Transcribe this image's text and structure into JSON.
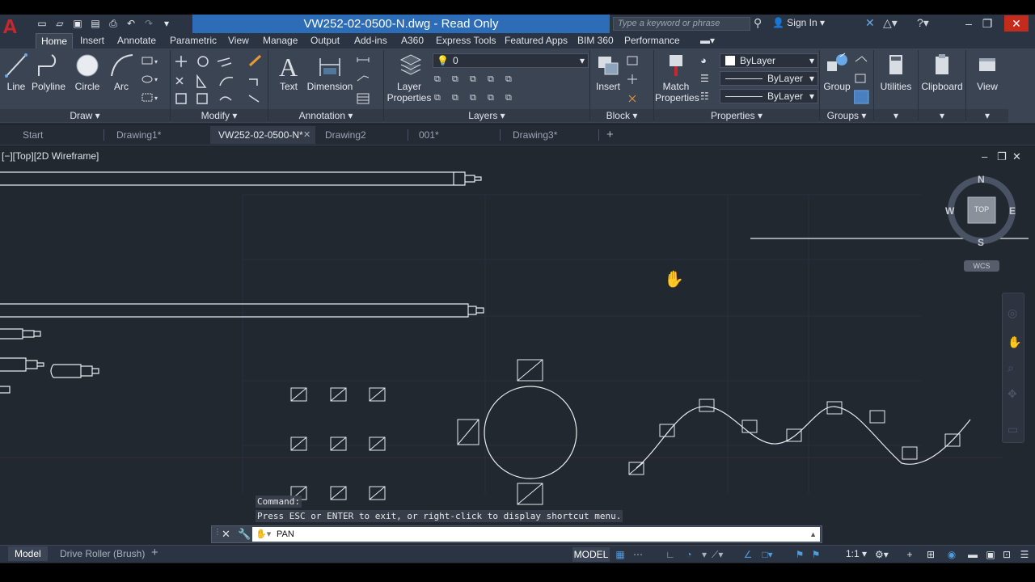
{
  "window": {
    "title": "VW252-02-0500-N.dwg - Read Only",
    "search_placeholder": "Type a keyword or phrase",
    "sign_in": "Sign In"
  },
  "ribbon_tabs": [
    {
      "label": "Home",
      "active": true
    },
    {
      "label": "Insert"
    },
    {
      "label": "Annotate"
    },
    {
      "label": "Parametric"
    },
    {
      "label": "View"
    },
    {
      "label": "Manage"
    },
    {
      "label": "Output"
    },
    {
      "label": "Add-ins"
    },
    {
      "label": "A360"
    },
    {
      "label": "Express Tools"
    },
    {
      "label": "Featured Apps"
    },
    {
      "label": "BIM 360"
    },
    {
      "label": "Performance"
    }
  ],
  "draw_panel": {
    "title": "Draw",
    "tools": [
      "Line",
      "Polyline",
      "Circle",
      "Arc"
    ]
  },
  "modify_panel": {
    "title": "Modify"
  },
  "annotation_panel": {
    "title": "Annotation",
    "tools": [
      "Text",
      "Dimension"
    ]
  },
  "layers_panel": {
    "title": "Layers",
    "layer_properties": "Layer\nProperties",
    "layer_properties_l1": "Layer",
    "layer_properties_l2": "Properties",
    "current_layer": "0"
  },
  "block_panel": {
    "title": "Block",
    "insert": "Insert"
  },
  "properties_panel": {
    "title": "Properties",
    "match_l1": "Match",
    "match_l2": "Properties",
    "color": "ByLayer",
    "linetype": "ByLayer",
    "lineweight": "ByLayer"
  },
  "groups_panel": {
    "title": "Groups",
    "group": "Group"
  },
  "utilities": "Utilities",
  "clipboard": "Clipboard",
  "view": "View",
  "file_tabs": [
    {
      "label": "Start"
    },
    {
      "label": "Drawing1*"
    },
    {
      "label": "VW252-02-0500-N*",
      "active": true
    },
    {
      "label": "Drawing2"
    },
    {
      "label": "001*"
    },
    {
      "label": "Drawing3*"
    }
  ],
  "viewport": {
    "label": "[−][Top][2D Wireframe]",
    "viewcube": {
      "n": "N",
      "s": "S",
      "e": "E",
      "w": "W",
      "top": "TOP",
      "wcs": "WCS"
    }
  },
  "command": {
    "history_1": "Command:",
    "history_2": "Press ESC or ENTER to exit, or right-click to display shortcut menu.",
    "current": "PAN"
  },
  "layout_tabs": [
    {
      "label": "Model",
      "active": true
    },
    {
      "label": "Drive Roller (Brush)"
    }
  ],
  "status": {
    "model": "MODEL",
    "scale": "1:1"
  },
  "colors": {
    "canvas": "#212830",
    "ribbon": "#3b4453",
    "title_accent": "#2d6db7",
    "app_red": "#c8282b"
  }
}
